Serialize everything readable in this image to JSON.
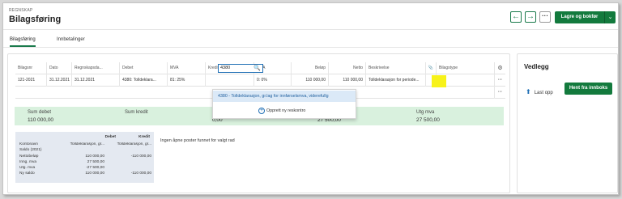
{
  "header": {
    "breadcrumb": "REGNSKAP",
    "title": "Bilagsføring",
    "back_icon": "←",
    "forward_icon": "→",
    "more_icon": "···",
    "save_label": "Lagre og bokfør",
    "save_dropdown_icon": "⌄"
  },
  "tabs": [
    {
      "label": "Bilagsføring",
      "active": true
    },
    {
      "label": "Innbetalinger",
      "active": false
    }
  ],
  "grid": {
    "columns": [
      "Bilagsnr",
      "Dato",
      "Regnskapsda...",
      "Debet",
      "MVA",
      "Kredit",
      "MVA",
      "Beløp",
      "Netto",
      "Beskrivelse",
      "",
      "Bilagstype"
    ],
    "row": {
      "bilagsnr": "121-2021",
      "dato": "31.12.2021",
      "regnskapsdato": "31.12.2021",
      "debet": "4380: Tolldeklara...",
      "mva_debet": "81: 25%",
      "kredit_input": "4380",
      "mva_kredit": "0: 0%",
      "belop": "110 000,00",
      "netto": "110 000,00",
      "beskrivelse": "Tolldeklarasjon for periode...",
      "bilagstype": ""
    },
    "settings_icon": "⚙",
    "row_more_icon": "···",
    "attach_icon": "📎",
    "search_icon": "🔍"
  },
  "dropdown": {
    "item": "4380 - Tolldeklarasjon, gr.lag for innførselsmva, viderefullg",
    "new_label": "Opprett ny reskontro",
    "plus_icon": "+"
  },
  "summary": {
    "sum_debet_label": "Sum debet",
    "sum_debet_value": "110 000,00",
    "sum_kredit_label": "Sum kredit",
    "sum_kredit_value": "0,00",
    "hidden_value": "27 500,00",
    "utg_mva_label": "Utg mva",
    "utg_mva_value": "27 500,00"
  },
  "balance": {
    "col_debet": "Debet",
    "col_kredit": "Kredit",
    "rows": [
      {
        "label": "Kontonavn",
        "debet": "Tolldeklarasjon, gr...",
        "kredit": "Tolldeklarasjon, gr..."
      },
      {
        "label": "Saldo (2021)",
        "debet": "",
        "kredit": ""
      },
      {
        "label": "Nettobeløp",
        "debet": "110 000,00",
        "kredit": "-110 000,00"
      },
      {
        "label": "Inng. mva",
        "debet": "27 500,00",
        "kredit": ""
      },
      {
        "label": "Utg. mva",
        "debet": "-27 500,00",
        "kredit": ""
      },
      {
        "label": "Ny saldo",
        "debet": "110 000,00",
        "kredit": "-110 000,00"
      }
    ]
  },
  "no_open_items": "Ingen åpne poster funnet for valgt rad",
  "attachments": {
    "title": "Vedlegg",
    "upload_label": "Last opp",
    "upload_icon": "⬆",
    "inbox_label": "Hent fra innboks"
  }
}
